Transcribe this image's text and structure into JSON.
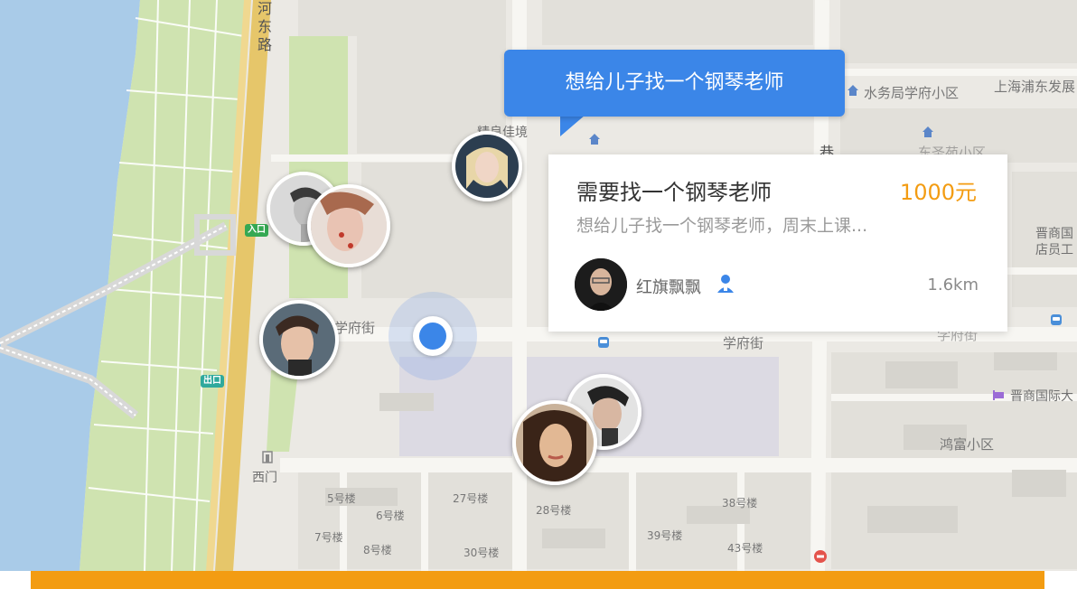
{
  "map": {
    "streets": {
      "road_vertical_1": "河东路",
      "xuefu_street_left": "学府街",
      "xuefu_street_mid": "学府街",
      "xuefu_street_right": "学府街",
      "chang_xiang": "长巷"
    },
    "places": {
      "shuiwuju": "水务局学府小区",
      "shanghai_pudong": "上海浦东发展",
      "jingyuan": "精良佳境",
      "dongsheng": "东圣苑小区",
      "jinshang_building": "晋商国际大",
      "jinshang_right": "晋商国\n店员工",
      "hongfu": "鸿富小区",
      "ximen": "西门"
    },
    "road_badges": {
      "entrance": "入口",
      "exit": "出口"
    },
    "buildings": {
      "b5": "5号楼",
      "b6": "6号楼",
      "b7": "7号楼",
      "b8": "8号楼",
      "b27": "27号楼",
      "b28": "28号楼",
      "b30": "30号楼",
      "b38": "38号楼",
      "b39": "39号楼",
      "b43": "43号楼"
    }
  },
  "bubble": {
    "text": "想给儿子找一个钢琴老师"
  },
  "card": {
    "title": "需要找一个钢琴老师",
    "price": "1000元",
    "description": "想给儿子找一个钢琴老师，周末上课...",
    "user_name": "红旗飘飘",
    "distance": "1.6km"
  },
  "colors": {
    "accent_blue": "#3b86e8",
    "price_orange": "#f39c12",
    "water": "#a9cbe8",
    "park_green": "#cfe3b0",
    "highway_yellow": "#e6c66a"
  },
  "icons": {
    "user_badge": "person-badge-icon",
    "current_location": "location-dot-icon"
  }
}
